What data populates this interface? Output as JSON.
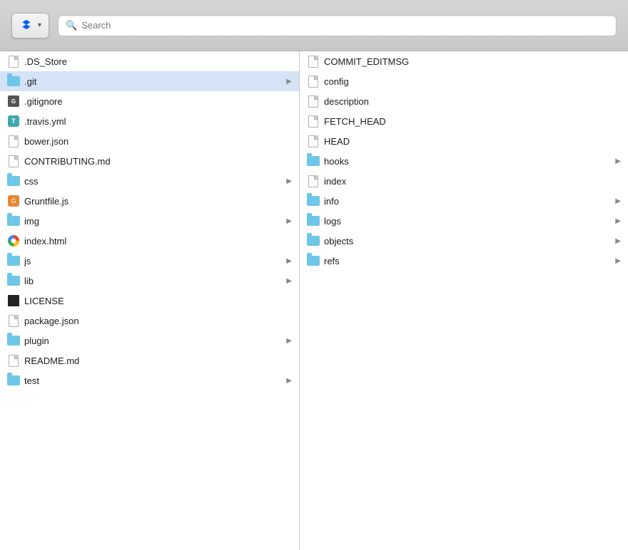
{
  "toolbar": {
    "dropbox_label": "Dropbox",
    "chevron": "▾",
    "search_placeholder": "Search"
  },
  "left_column": {
    "items": [
      {
        "name": ".DS_Store",
        "type": "file",
        "icon": "generic",
        "has_arrow": false,
        "selected": false
      },
      {
        "name": ".git",
        "type": "folder",
        "icon": "folder",
        "has_arrow": true,
        "selected": true
      },
      {
        "name": ".gitignore",
        "type": "gitignore",
        "icon": "gitignore",
        "has_arrow": false,
        "selected": false
      },
      {
        "name": ".travis.yml",
        "type": "travis",
        "icon": "travis",
        "has_arrow": false,
        "selected": false
      },
      {
        "name": "bower.json",
        "type": "file",
        "icon": "generic",
        "has_arrow": false,
        "selected": false
      },
      {
        "name": "CONTRIBUTING.md",
        "type": "file",
        "icon": "generic",
        "has_arrow": false,
        "selected": false
      },
      {
        "name": "css",
        "type": "folder",
        "icon": "folder",
        "has_arrow": true,
        "selected": false
      },
      {
        "name": "Gruntfile.js",
        "type": "grunt",
        "icon": "grunt",
        "has_arrow": false,
        "selected": false
      },
      {
        "name": "img",
        "type": "folder",
        "icon": "folder",
        "has_arrow": true,
        "selected": false
      },
      {
        "name": "index.html",
        "type": "chrome",
        "icon": "chrome",
        "has_arrow": false,
        "selected": false
      },
      {
        "name": "js",
        "type": "folder",
        "icon": "folder",
        "has_arrow": true,
        "selected": false
      },
      {
        "name": "lib",
        "type": "folder",
        "icon": "folder",
        "has_arrow": true,
        "selected": false
      },
      {
        "name": "LICENSE",
        "type": "license",
        "icon": "license",
        "has_arrow": false,
        "selected": false
      },
      {
        "name": "package.json",
        "type": "file",
        "icon": "generic",
        "has_arrow": false,
        "selected": false
      },
      {
        "name": "plugin",
        "type": "folder",
        "icon": "folder",
        "has_arrow": true,
        "selected": false
      },
      {
        "name": "README.md",
        "type": "file",
        "icon": "generic",
        "has_arrow": false,
        "selected": false
      },
      {
        "name": "test",
        "type": "folder",
        "icon": "folder",
        "has_arrow": true,
        "selected": false
      }
    ]
  },
  "right_column": {
    "items": [
      {
        "name": "COMMIT_EDITMSG",
        "type": "file",
        "icon": "generic",
        "has_arrow": false,
        "selected": false
      },
      {
        "name": "config",
        "type": "file",
        "icon": "generic",
        "has_arrow": false,
        "selected": false
      },
      {
        "name": "description",
        "type": "file",
        "icon": "generic",
        "has_arrow": false,
        "selected": false
      },
      {
        "name": "FETCH_HEAD",
        "type": "file",
        "icon": "generic",
        "has_arrow": false,
        "selected": false
      },
      {
        "name": "HEAD",
        "type": "file",
        "icon": "generic",
        "has_arrow": false,
        "selected": false
      },
      {
        "name": "hooks",
        "type": "folder",
        "icon": "folder",
        "has_arrow": true,
        "selected": false
      },
      {
        "name": "index",
        "type": "file",
        "icon": "generic",
        "has_arrow": false,
        "selected": false
      },
      {
        "name": "info",
        "type": "folder",
        "icon": "folder",
        "has_arrow": true,
        "selected": false
      },
      {
        "name": "logs",
        "type": "folder",
        "icon": "folder",
        "has_arrow": true,
        "selected": false
      },
      {
        "name": "objects",
        "type": "folder",
        "icon": "folder",
        "has_arrow": true,
        "selected": false
      },
      {
        "name": "refs",
        "type": "folder",
        "icon": "folder",
        "has_arrow": true,
        "selected": false
      }
    ]
  }
}
